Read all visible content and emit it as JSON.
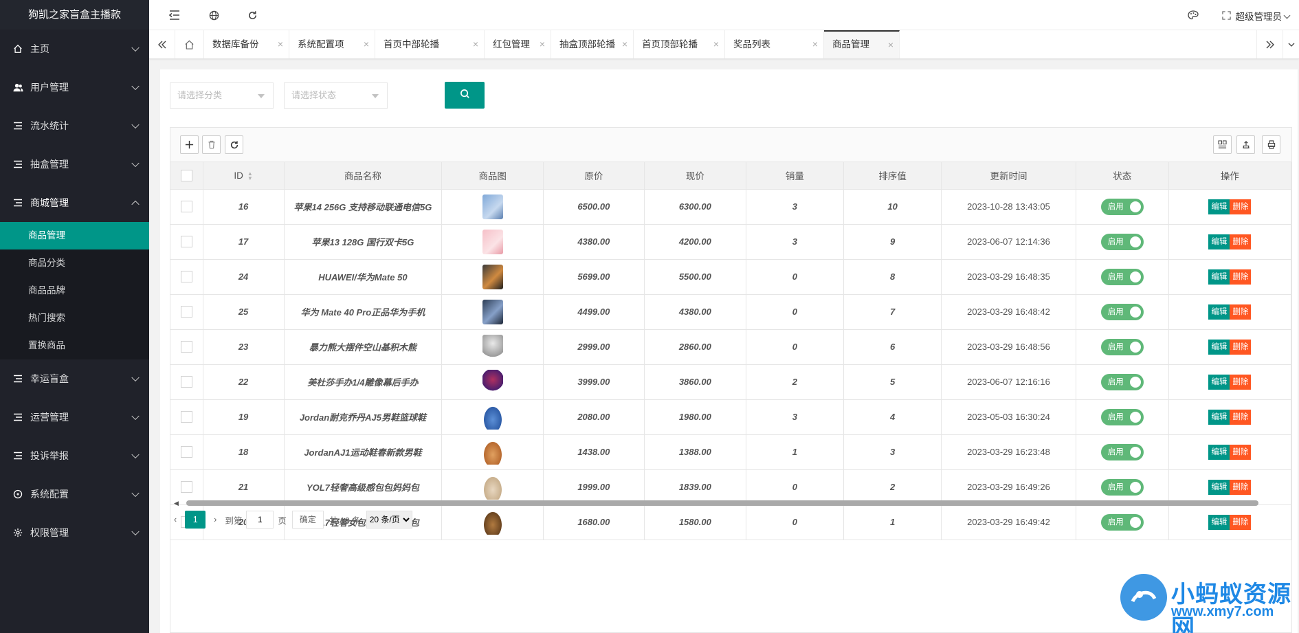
{
  "app": {
    "title": "狗凯之家盲盒主播款"
  },
  "sidebar": {
    "items": [
      {
        "label": "主页",
        "icon": "home-icon"
      },
      {
        "label": "用户管理",
        "icon": "users-icon"
      },
      {
        "label": "流水统计",
        "icon": "list-icon"
      },
      {
        "label": "抽盒管理",
        "icon": "list-icon"
      },
      {
        "label": "商城管理",
        "icon": "list-icon",
        "open": true
      }
    ],
    "sub_items": [
      {
        "label": "商品管理",
        "active": true
      },
      {
        "label": "商品分类"
      },
      {
        "label": "商品品牌"
      },
      {
        "label": "热门搜索"
      },
      {
        "label": "置换商品"
      }
    ],
    "items_after": [
      {
        "label": "幸运盲盒",
        "icon": "list-icon"
      },
      {
        "label": "运营管理",
        "icon": "list-icon"
      },
      {
        "label": "投诉举报",
        "icon": "list-icon"
      },
      {
        "label": "系统配置",
        "icon": "settings-icon"
      },
      {
        "label": "权限管理",
        "icon": "gear-icon"
      }
    ]
  },
  "header": {
    "user": "超级管理员"
  },
  "tabs": [
    "数据库备份",
    "系统配置项",
    "首页中部轮播",
    "红包管理",
    "抽盒顶部轮播",
    "首页顶部轮播",
    "奖品列表",
    "商品管理"
  ],
  "filters": {
    "category_placeholder": "请选择分类",
    "status_placeholder": "请选择状态"
  },
  "table": {
    "columns": [
      "ID",
      "商品名称",
      "商品图",
      "原价",
      "现价",
      "销量",
      "排序值",
      "更新时间",
      "状态",
      "操作"
    ],
    "status_label": "启用",
    "edit_label": "编辑",
    "delete_label": "删除",
    "rows": [
      {
        "id": "16",
        "name": "苹果14 256G 支持移动联通电信5G",
        "img": "phone-blue",
        "original": "6500.00",
        "price": "6300.00",
        "sales": "3",
        "sort": "10",
        "updated": "2023-10-28 13:43:05"
      },
      {
        "id": "17",
        "name": "苹果13 128G 国行双卡5G",
        "img": "phone-pink",
        "original": "4380.00",
        "price": "4200.00",
        "sales": "3",
        "sort": "9",
        "updated": "2023-06-07 12:14:36"
      },
      {
        "id": "24",
        "name": "HUAWEI/华为Mate 50",
        "img": "phone-black",
        "original": "5699.00",
        "price": "5500.00",
        "sales": "0",
        "sort": "8",
        "updated": "2023-03-29 16:48:35"
      },
      {
        "id": "25",
        "name": "华为 Mate 40 Pro正品华为手机",
        "img": "phone-dark",
        "original": "4499.00",
        "price": "4380.00",
        "sales": "0",
        "sort": "7",
        "updated": "2023-03-29 16:48:42"
      },
      {
        "id": "23",
        "name": "暴力熊大摆件空山基积木熊",
        "img": "bear-figure",
        "original": "2999.00",
        "price": "2860.00",
        "sales": "0",
        "sort": "6",
        "updated": "2023-03-29 16:48:56"
      },
      {
        "id": "22",
        "name": "美杜莎手办1/4雕像幕后手办",
        "img": "figure-purple",
        "original": "3999.00",
        "price": "3860.00",
        "sales": "2",
        "sort": "5",
        "updated": "2023-06-07 12:16:16"
      },
      {
        "id": "19",
        "name": "Jordan耐克乔丹AJ5男鞋篮球鞋",
        "img": "shoe-blue",
        "original": "2080.00",
        "price": "1980.00",
        "sales": "3",
        "sort": "4",
        "updated": "2023-05-03 16:30:24"
      },
      {
        "id": "18",
        "name": "JordanAJ1运动鞋春新款男鞋",
        "img": "shoe-orange",
        "original": "1438.00",
        "price": "1388.00",
        "sales": "1",
        "sort": "3",
        "updated": "2023-03-29 16:23:48"
      },
      {
        "id": "21",
        "name": "YOL7轻奢高级感包包妈妈包",
        "img": "bag-beige",
        "original": "1999.00",
        "price": "1839.00",
        "sales": "0",
        "sort": "2",
        "updated": "2023-03-29 16:49:26"
      },
      {
        "id": "20",
        "name": "YOL7轻奢女包高级感复古包",
        "img": "bag-brown",
        "original": "1680.00",
        "price": "1580.00",
        "sales": "0",
        "sort": "1",
        "updated": "2023-03-29 16:49:42"
      }
    ]
  },
  "pager": {
    "current": "1",
    "goto_label": "到第",
    "page_input": "1",
    "page_unit": "页",
    "confirm_label": "确定",
    "total": "共 10 条",
    "page_size": "20 条/页"
  },
  "watermark": {
    "line1": "小蚂蚁资源网",
    "line2": "www.xmy7.com"
  },
  "colors": {
    "accent": "#009688",
    "sidebar_bg": "#20222a",
    "switch_on": "#5fb878",
    "delete": "#ff5722"
  }
}
